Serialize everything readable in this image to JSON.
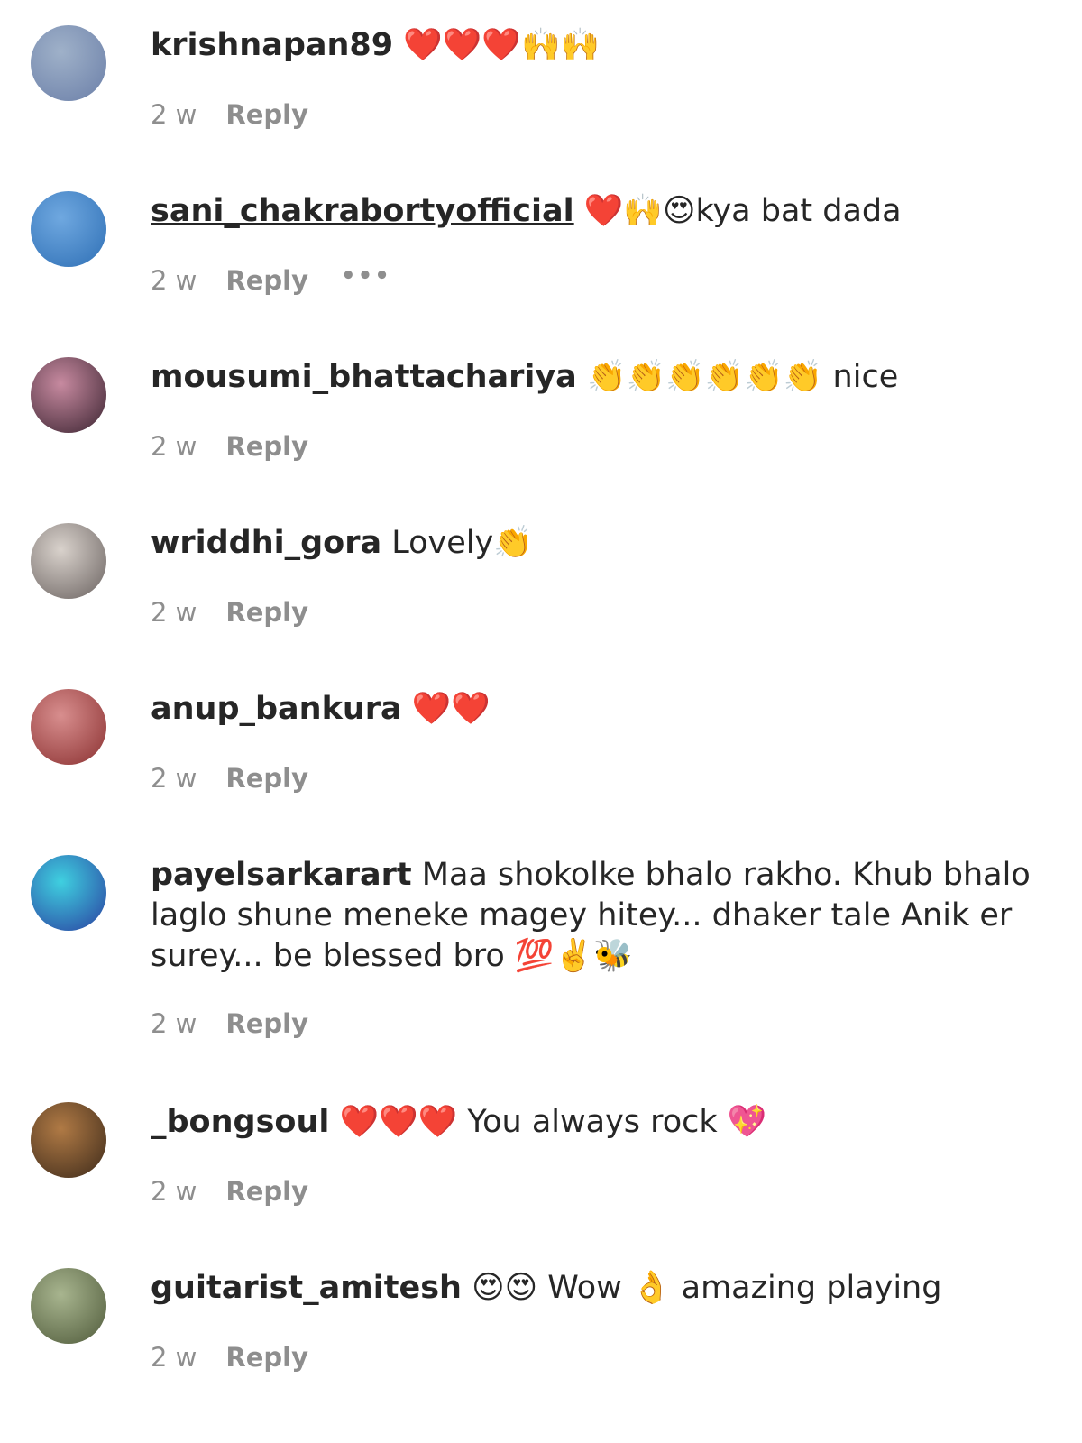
{
  "comments": [
    {
      "username": "krishnapan89",
      "text": "❤️❤️❤️🙌🙌",
      "time": "2 w",
      "reply": "Reply",
      "avatar_color": "#6b7fa8",
      "avatar_color2": "#9fb1c9"
    },
    {
      "username": "sani_chakrabortyofficial",
      "text": "❤️🙌😍kya bat dada",
      "time": "2 w",
      "reply": "Reply",
      "more": "•••",
      "avatar_color": "#2e6fb5",
      "avatar_color2": "#6fa8e0"
    },
    {
      "username": "mousumi_bhattachariya",
      "text": "👏👏👏👏👏👏 nice",
      "time": "2 w",
      "reply": "Reply",
      "avatar_color": "#3a2330",
      "avatar_color2": "#c78aa0"
    },
    {
      "username": "wriddhi_gora",
      "text": "Lovely👏",
      "time": "2 w",
      "reply": "Reply",
      "avatar_color": "#6a6260",
      "avatar_color2": "#d9d2cc"
    },
    {
      "username": "anup_bankura",
      "text": "❤️❤️",
      "time": "2 w",
      "reply": "Reply",
      "avatar_color": "#8a3030",
      "avatar_color2": "#d88e8e"
    },
    {
      "username": "payelsarkarart",
      "text": "Maa shokolke bhalo rakho. Khub bhalo laglo shune meneke magey hitey... dhaker tale Anik er surey... be blessed bro 💯✌️🐝",
      "time": "2 w",
      "reply": "Reply",
      "avatar_color": "#2a3fa0",
      "avatar_color2": "#3fd0e0"
    },
    {
      "username": "_bongsoul",
      "text": "❤️❤️❤️ You always rock 💖",
      "time": "2 w",
      "reply": "Reply",
      "avatar_color": "#3d2a1a",
      "avatar_color2": "#b07a45"
    },
    {
      "username": "guitarist_amitesh",
      "text": "😍😍 Wow 👌 amazing playing",
      "time": "2 w",
      "reply": "Reply",
      "avatar_color": "#4f5a3a",
      "avatar_color2": "#a8b58f"
    }
  ]
}
